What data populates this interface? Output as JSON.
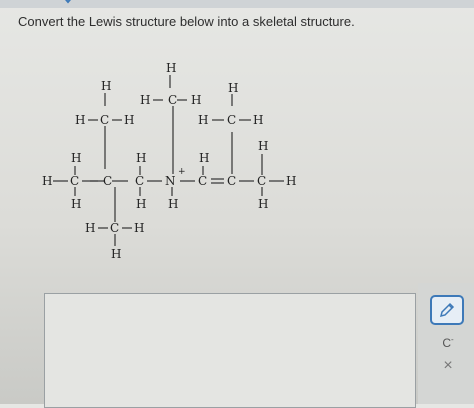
{
  "question": {
    "prompt": "Convert the Lewis structure below into a skeletal structure."
  },
  "toolbar": {
    "charge_label": "C",
    "charge_sup": "-",
    "close_label": "×"
  },
  "atoms": {
    "H": "H",
    "C": "C",
    "N": "N",
    "plus": "+"
  },
  "colors": {
    "accent": "#3d79b8"
  }
}
